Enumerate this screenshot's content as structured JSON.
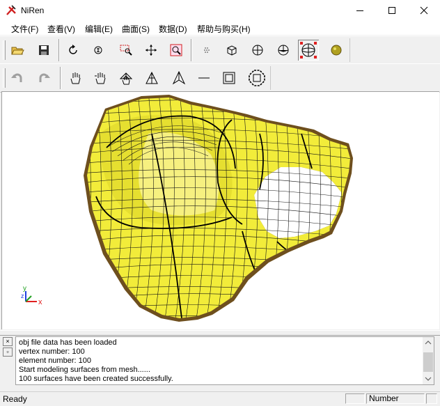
{
  "window": {
    "title": "NiRen"
  },
  "menu": [
    "文件(F)",
    "查看(V)",
    "编辑(E)",
    "曲面(S)",
    "数据(D)",
    "帮助与购买(H)"
  ],
  "toolbar1": [
    {
      "name": "open-icon"
    },
    {
      "name": "save-icon"
    },
    {
      "name": "rotate-icon"
    },
    {
      "name": "zoom-icon"
    },
    {
      "name": "zoom-window-icon"
    },
    {
      "name": "pan-icon"
    },
    {
      "name": "zoom-extents-icon"
    },
    {
      "name": "point-cloud-icon"
    },
    {
      "name": "cube-icon"
    },
    {
      "name": "sphere-icon"
    },
    {
      "name": "shaded-sphere-icon"
    },
    {
      "name": "selected-sphere-icon",
      "active": true
    },
    {
      "name": "color-ball-icon"
    }
  ],
  "toolbar2": [
    {
      "name": "undo-icon"
    },
    {
      "name": "redo-icon"
    },
    {
      "name": "hand-icon"
    },
    {
      "name": "multi-hand-icon"
    },
    {
      "name": "grid-hand-icon"
    },
    {
      "name": "triangle-icon"
    },
    {
      "name": "triangle-edit-icon"
    },
    {
      "name": "line-icon"
    },
    {
      "name": "square-icon"
    },
    {
      "name": "octagon-icon"
    }
  ],
  "output_lines": [
    "obj file data has been loaded",
    "vertex number: 100",
    "element number: 100",
    "Start modeling surfaces from mesh......",
    "100 surfaces have been created successfully."
  ],
  "status": {
    "text": "Ready",
    "number_label": "Number"
  },
  "colors": {
    "surface": "#f2ec3a",
    "surface_shadow": "#6e4f1e",
    "mesh": "#141414",
    "axis_x": "#e02020",
    "axis_y": "#20a020",
    "axis_z": "#2040e0"
  }
}
